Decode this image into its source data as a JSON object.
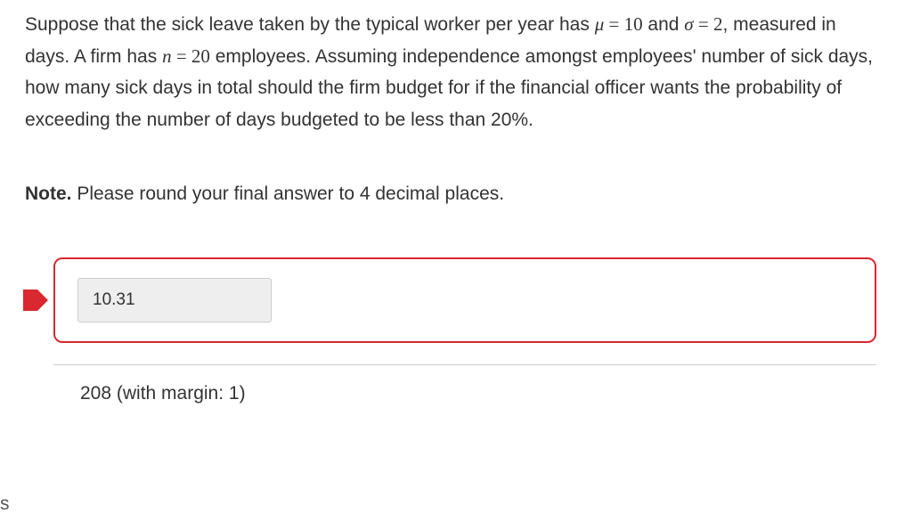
{
  "question": {
    "part1": "Suppose that the sick leave taken by the typical worker per year has ",
    "mu_var": "μ",
    "eq1": " = ",
    "mu_val": "10",
    "part2": " and ",
    "sigma_var": "σ",
    "eq2": " = ",
    "sigma_val": "2",
    "part3": ", measured in days. A firm has ",
    "n_var": "n",
    "eq3": " = ",
    "n_val": "20",
    "part4": " employees. Assuming independence amongst employees' number of sick days, how many sick days in total should the firm budget for if the financial officer wants the probability of exceeding the number of days budgeted to be less than 20%."
  },
  "note": {
    "label": "Note.",
    "text": " Please round your final answer to 4 decimal places."
  },
  "answer": {
    "submitted": "10.31",
    "correct": "208 (with margin: 1)"
  },
  "side_label_char": "s"
}
